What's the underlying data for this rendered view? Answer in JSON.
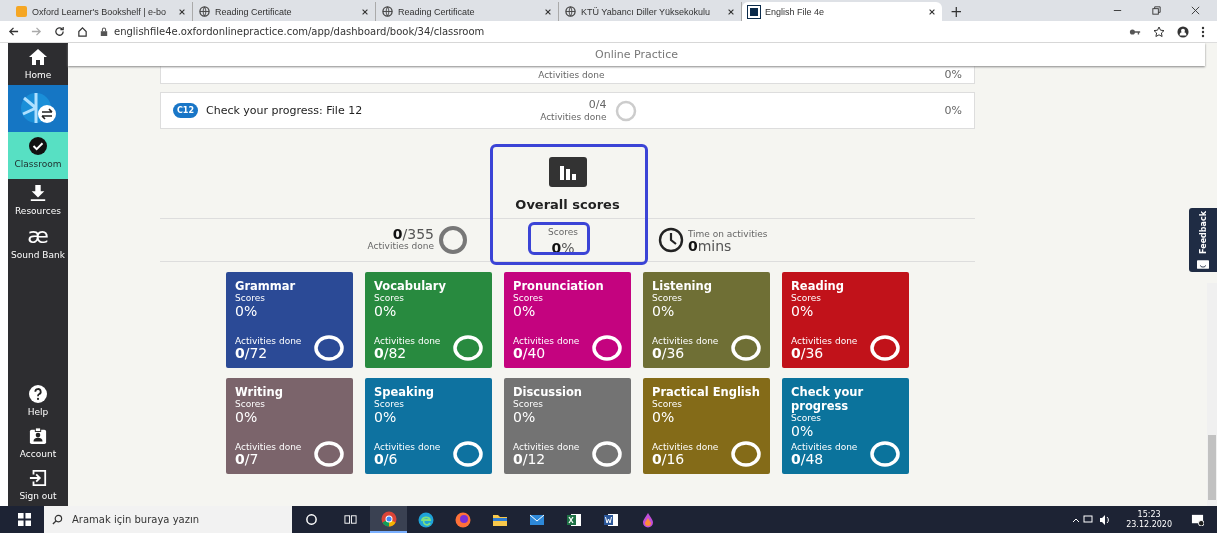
{
  "browser": {
    "tabs": [
      {
        "title": "Oxford Learner's Bookshelf | e-bo",
        "selected": false
      },
      {
        "title": "Reading Certificate",
        "selected": false
      },
      {
        "title": "Reading Certificate",
        "selected": false
      },
      {
        "title": "KTÜ Yabancı Diller Yüksekokulu",
        "selected": false
      },
      {
        "title": "English File 4e",
        "selected": true
      }
    ],
    "new_tab": "+",
    "url": "englishfile4e.oxfordonlinepractice.com/app/dashboard/book/34/classroom"
  },
  "sidebar": {
    "items": [
      {
        "label": "Home",
        "selected": false
      },
      {
        "selected": false
      },
      {
        "label": "Classroom",
        "selected": true
      },
      {
        "label": "Resources",
        "selected": false
      },
      {
        "glyph": "æ",
        "label": "Sound Bank",
        "selected": false
      }
    ],
    "bottom_items": [
      {
        "label": "Help"
      },
      {
        "label": "Account"
      },
      {
        "label": "Sign out"
      }
    ]
  },
  "header": {
    "title": "Online Practice"
  },
  "partial_row": {
    "activities": "Activities done",
    "score": "0%"
  },
  "unit_row": {
    "badge": "C12",
    "title": "Check your progress: File 12",
    "done": "0/4",
    "activities": "Activities done",
    "score": "0%"
  },
  "overall": {
    "title": "Overall scores",
    "activities": {
      "done": "0",
      "total": "/355",
      "label": "Activities done"
    },
    "scores": {
      "label": "Scores",
      "value": "0",
      "unit": "%"
    },
    "time": {
      "label": "Time on activities",
      "value": "0",
      "unit": "mins"
    }
  },
  "tiles": [
    {
      "name": "Grammar",
      "scores_label": "Scores",
      "score": "0%",
      "activities_label": "Activities done",
      "done": "0",
      "total": "/72",
      "color": "#2b4a96"
    },
    {
      "name": "Vocabulary",
      "scores_label": "Scores",
      "score": "0%",
      "activities_label": "Activities done",
      "done": "0",
      "total": "/82",
      "color": "#288a3f"
    },
    {
      "name": "Pronunciation",
      "scores_label": "Scores",
      "score": "0%",
      "activities_label": "Activities done",
      "done": "0",
      "total": "/40",
      "color": "#c4037f"
    },
    {
      "name": "Listening",
      "scores_label": "Scores",
      "score": "0%",
      "activities_label": "Activities done",
      "done": "0",
      "total": "/36",
      "color": "#6f6f35"
    },
    {
      "name": "Reading",
      "scores_label": "Scores",
      "score": "0%",
      "activities_label": "Activities done",
      "done": "0",
      "total": "/36",
      "color": "#c1121a"
    },
    {
      "name": "Writing",
      "scores_label": "Scores",
      "score": "0%",
      "activities_label": "Activities done",
      "done": "0",
      "total": "/7",
      "color": "#7b646b"
    },
    {
      "name": "Speaking",
      "scores_label": "Scores",
      "score": "0%",
      "activities_label": "Activities done",
      "done": "0",
      "total": "/6",
      "color": "#0e72a0"
    },
    {
      "name": "Discussion",
      "scores_label": "Scores",
      "score": "0%",
      "activities_label": "Activities done",
      "done": "0",
      "total": "/12",
      "color": "#737373"
    },
    {
      "name": "Practical English",
      "scores_label": "Scores",
      "score": "0%",
      "activities_label": "Activities done",
      "done": "0",
      "total": "/16",
      "color": "#846b18"
    },
    {
      "name": "Check your progress",
      "scores_label": "Scores",
      "score": "0%",
      "activities_label": "Activities done",
      "done": "0",
      "total": "/48",
      "color": "#0b739c"
    }
  ],
  "feedback": "Feedback",
  "taskbar": {
    "search_placeholder": "Aramak için buraya yazın",
    "time": "15:23",
    "date": "23.12.2020"
  }
}
